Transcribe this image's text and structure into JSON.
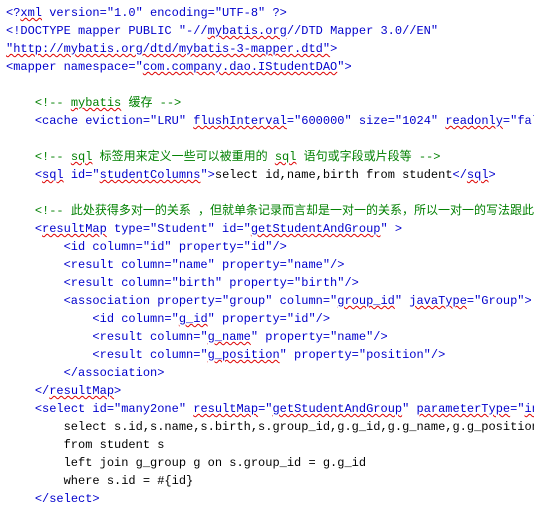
{
  "lines": [
    {
      "cls": "blue",
      "segs": [
        {
          "t": "<?"
        },
        {
          "t": "xml",
          "err": true
        },
        {
          "t": " version=\"1.0\" encoding=\"UTF-8\" ?>"
        }
      ]
    },
    {
      "cls": "blue",
      "segs": [
        {
          "t": "<!DOCTYPE mapper PUBLIC \"-//"
        },
        {
          "t": "mybatis.org",
          "err": true
        },
        {
          "t": "//DTD Mapper 3.0//EN\""
        }
      ]
    },
    {
      "cls": "blue",
      "segs": [
        {
          "t": "\"http://mybatis.org/dtd/mybatis-3-mapper.dtd\"",
          "err": true
        },
        {
          "t": ">"
        }
      ]
    },
    {
      "cls": "blue",
      "segs": [
        {
          "t": "<mapper namespace=\""
        },
        {
          "t": "com.company.dao.IStudentDAO",
          "err": true
        },
        {
          "t": "\">"
        }
      ]
    },
    {
      "cls": "blue",
      "segs": [
        {
          "t": " "
        }
      ]
    },
    {
      "cls": "green",
      "indent": 1,
      "segs": [
        {
          "t": "<!-- "
        },
        {
          "t": "mybatis",
          "err": true
        },
        {
          "t": " 缓存 -->"
        }
      ]
    },
    {
      "cls": "blue",
      "indent": 1,
      "segs": [
        {
          "t": "<cache eviction=\"LRU\" "
        },
        {
          "t": "flushInterval",
          "err": true
        },
        {
          "t": "=\"600000\" size=\"1024\" "
        },
        {
          "t": "readonly",
          "err": true
        },
        {
          "t": "=\"false\" />"
        }
      ]
    },
    {
      "cls": "blue",
      "segs": [
        {
          "t": " "
        }
      ]
    },
    {
      "cls": "green",
      "indent": 1,
      "segs": [
        {
          "t": "<!-- "
        },
        {
          "t": "sql",
          "err": true
        },
        {
          "t": " 标签用来定义一些可以被重用的 "
        },
        {
          "t": "sql",
          "err": true
        },
        {
          "t": " 语句或字段或片段等 -->"
        }
      ]
    },
    {
      "cls": "blue",
      "indent": 1,
      "segs": [
        {
          "t": "<"
        },
        {
          "t": "sql",
          "err": true
        },
        {
          "t": " id=\""
        },
        {
          "t": "studentColumns",
          "err": true
        },
        {
          "t": "\">"
        },
        {
          "t": "select id,name,birth from student",
          "cls": "black"
        },
        {
          "t": "</"
        },
        {
          "t": "sql",
          "err": true
        },
        {
          "t": ">"
        }
      ]
    },
    {
      "cls": "blue",
      "segs": [
        {
          "t": " "
        }
      ]
    },
    {
      "cls": "green",
      "indent": 1,
      "segs": [
        {
          "t": "<!-- 此处获得多对一的关系 ，但就单条记录而言却是一对一的关系，所以一对一的写法跟此相同-->"
        }
      ]
    },
    {
      "cls": "blue",
      "indent": 1,
      "segs": [
        {
          "t": "<"
        },
        {
          "t": "resultMap",
          "err": true
        },
        {
          "t": " type=\"Student\" id=\""
        },
        {
          "t": "getStudentAndGroup",
          "err": true
        },
        {
          "t": "\" >"
        }
      ]
    },
    {
      "cls": "blue",
      "indent": 2,
      "segs": [
        {
          "t": "<id column=\"id\" property=\"id\"/>"
        }
      ]
    },
    {
      "cls": "blue",
      "indent": 2,
      "segs": [
        {
          "t": "<result column=\"name\" property=\"name\"/>"
        }
      ]
    },
    {
      "cls": "blue",
      "indent": 2,
      "segs": [
        {
          "t": "<result column=\"birth\" property=\"birth\"/>"
        }
      ]
    },
    {
      "cls": "blue",
      "indent": 2,
      "segs": [
        {
          "t": "<association property=\"group\" column=\""
        },
        {
          "t": "group_id",
          "err": true
        },
        {
          "t": "\" "
        },
        {
          "t": "javaType",
          "err": true
        },
        {
          "t": "=\"Group\">"
        }
      ]
    },
    {
      "cls": "blue",
      "indent": 3,
      "segs": [
        {
          "t": "<id column=\""
        },
        {
          "t": "g_id",
          "err": true
        },
        {
          "t": "\" property=\"id\"/>"
        }
      ]
    },
    {
      "cls": "blue",
      "indent": 3,
      "segs": [
        {
          "t": "<result column=\""
        },
        {
          "t": "g_name",
          "err": true
        },
        {
          "t": "\" property=\"name\"/>"
        }
      ]
    },
    {
      "cls": "blue",
      "indent": 3,
      "segs": [
        {
          "t": "<result column=\""
        },
        {
          "t": "g_position",
          "err": true
        },
        {
          "t": "\" property=\"position\"/>"
        }
      ]
    },
    {
      "cls": "blue",
      "indent": 2,
      "segs": [
        {
          "t": "</association>"
        }
      ]
    },
    {
      "cls": "blue",
      "indent": 1,
      "segs": [
        {
          "t": "</"
        },
        {
          "t": "resultMap",
          "err": true
        },
        {
          "t": ">"
        }
      ]
    },
    {
      "cls": "blue",
      "indent": 1,
      "segs": [
        {
          "t": "<select id=\"many2one\" "
        },
        {
          "t": "resultMap",
          "err": true
        },
        {
          "t": "=\""
        },
        {
          "t": "getStudentAndGroup",
          "err": true
        },
        {
          "t": "\" "
        },
        {
          "t": "parameterType",
          "err": true
        },
        {
          "t": "=\""
        },
        {
          "t": "int",
          "err": true
        },
        {
          "t": "\" >"
        }
      ]
    },
    {
      "cls": "black",
      "indent": 2,
      "segs": [
        {
          "t": "select s.id,s.name,s.birth,s.group_id,g.g_id,g.g_name,g.g_position"
        }
      ]
    },
    {
      "cls": "black",
      "indent": 2,
      "segs": [
        {
          "t": "from student s"
        }
      ]
    },
    {
      "cls": "black",
      "indent": 2,
      "segs": [
        {
          "t": "left join g_group g on s.group_id = g.g_id"
        }
      ]
    },
    {
      "cls": "black",
      "indent": 2,
      "segs": [
        {
          "t": "where s.id = #{id}"
        }
      ]
    },
    {
      "cls": "blue",
      "indent": 1,
      "segs": [
        {
          "t": "</select>"
        }
      ]
    }
  ]
}
